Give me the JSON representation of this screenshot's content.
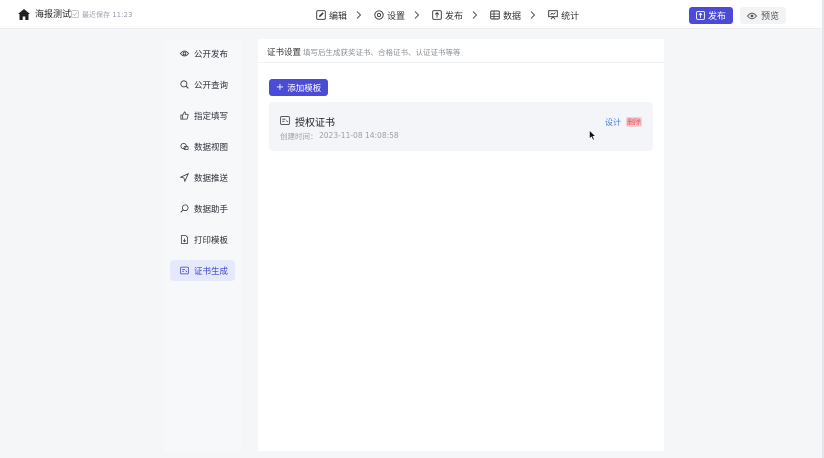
{
  "app": {
    "title": "海报测试",
    "save_status": "最近保存 11:23"
  },
  "steps": [
    {
      "label": "编辑",
      "icon": "edit-icon"
    },
    {
      "label": "设置",
      "icon": "gear-icon"
    },
    {
      "label": "发布",
      "icon": "upload-icon"
    },
    {
      "label": "数据",
      "icon": "database-icon"
    },
    {
      "label": "统计",
      "icon": "chart-icon"
    }
  ],
  "header_actions": {
    "publish_label": "发布",
    "preview_label": "预览"
  },
  "sidebar": {
    "items": [
      {
        "label": "公开发布",
        "icon": "eye-icon"
      },
      {
        "label": "公开查询",
        "icon": "search-icon"
      },
      {
        "label": "指定填写",
        "icon": "thumb-icon"
      },
      {
        "label": "数据视图",
        "icon": "layers-icon"
      },
      {
        "label": "数据推送",
        "icon": "send-icon"
      },
      {
        "label": "数据助手",
        "icon": "magic-search-icon"
      },
      {
        "label": "打印模板",
        "icon": "print-doc-icon"
      },
      {
        "label": "证书生成",
        "icon": "certificate-icon",
        "active": true
      }
    ]
  },
  "main": {
    "title": "证书设置",
    "description": "填写后生成获奖证书、合格证书、认证证书等等",
    "add_button": "添加模板",
    "card": {
      "title": "授权证书",
      "time_label": "创建时间：",
      "time_value": "2023-11-08 14:08:58",
      "design_label": "设计",
      "delete_label": "删除"
    }
  },
  "colors": {
    "accent": "#4b4bd8",
    "active_bg": "#e6e8fb",
    "delete_bg": "#f6cfd2",
    "delete_text": "#e04a55",
    "link": "#3f7bd6"
  }
}
